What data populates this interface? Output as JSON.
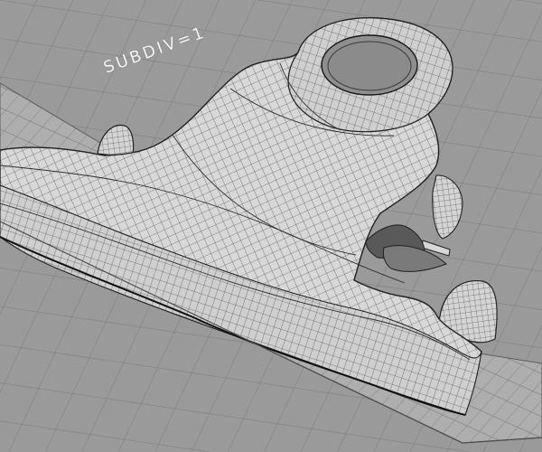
{
  "viewport": {
    "label": "SUBDIV=1"
  }
}
